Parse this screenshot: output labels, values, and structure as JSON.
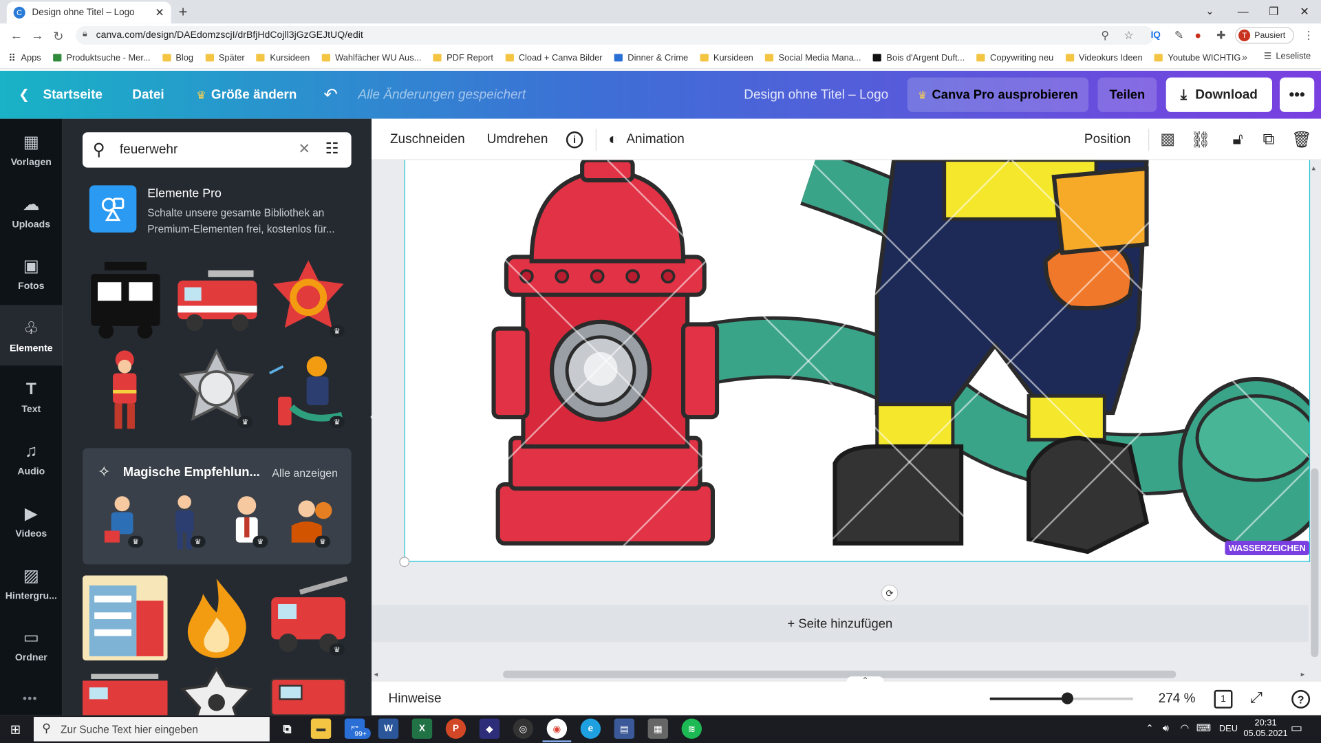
{
  "browser": {
    "tab_title": "Design ohne Titel – Logo",
    "tab_icon": "C",
    "url": "canva.com/design/DAEdomzscjI/drBfjHdCojll3jGzGEJtUQ/edit",
    "profile_initial": "T",
    "profile_status": "Pausiert",
    "bookmarks": [
      "Apps",
      "Produktsuche - Mer...",
      "Blog",
      "Später",
      "Kursideen",
      "Wahlfächer WU Aus...",
      "PDF Report",
      "Cload + Canva Bilder",
      "Dinner & Crime",
      "Kursideen",
      "Social Media Mana...",
      "Bois d'Argent Duft...",
      "Copywriting neu",
      "Videokurs Ideen",
      "Youtube WICHTIG"
    ],
    "reading_list": "Leseliste"
  },
  "header": {
    "home": "Startseite",
    "file": "Datei",
    "resize": "Größe ändern",
    "saved": "Alle Änderungen gespeichert",
    "title": "Design ohne Titel – Logo",
    "pro": "Canva Pro ausprobieren",
    "share": "Teilen",
    "download": "Download",
    "more": "•••",
    "accent": "#7a3fe0"
  },
  "rail": [
    {
      "label": "Vorlagen",
      "icon": "▦"
    },
    {
      "label": "Uploads",
      "icon": "☁"
    },
    {
      "label": "Fotos",
      "icon": "▣"
    },
    {
      "label": "Elemente",
      "icon": "♧"
    },
    {
      "label": "Text",
      "icon": "T"
    },
    {
      "label": "Audio",
      "icon": "♫"
    },
    {
      "label": "Videos",
      "icon": "▶"
    },
    {
      "label": "Hintergru...",
      "icon": "▨"
    },
    {
      "label": "Ordner",
      "icon": "▭"
    }
  ],
  "panel": {
    "search_value": "feuerwehr",
    "pro_title": "Elemente Pro",
    "pro_desc": "Schalte unsere gesamte Bibliothek an Premium-Elementen frei, kostenlos für...",
    "magic_title": "Magische Empfehlun...",
    "magic_all": "Alle anzeigen",
    "crown": "♛"
  },
  "toolbar": {
    "crop": "Zuschneiden",
    "flip": "Umdrehen",
    "info": "i",
    "animation": "Animation",
    "position": "Position"
  },
  "canvas": {
    "watermark": "WASSERZEICHEN",
    "add_page": "+ Seite hinzufügen"
  },
  "footer": {
    "notes": "Hinweise",
    "zoom": "274 %",
    "zoom_level": 0.54,
    "page_count": "1",
    "help": "?"
  },
  "taskbar": {
    "search": "Zur Suche Text hier eingeben",
    "badge": "99+",
    "lang": "DEU",
    "time": "20:31",
    "date": "05.05.2021"
  }
}
